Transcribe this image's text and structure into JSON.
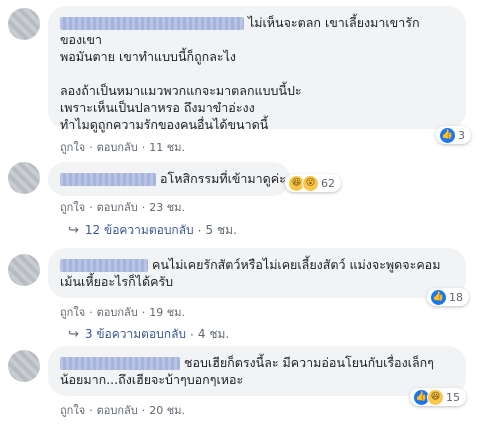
{
  "action_like": "ถูกใจ",
  "action_reply": "ตอบกลับ",
  "comments": [
    {
      "lines": [
        "ไม่เห็นจะตลก เขาเลี้ยงมาเขารัก",
        "ของเขา",
        "พอมันตาย เขาทำแบบนี้ก็ถูกละไง",
        "",
        "ลองถ้าเป็นหมาแมวพวกแกจะมาตลกแบบนี้ปะ",
        "เพราะเห็นเป็นปลาหรอ ถึงมาขำอ่ะงง",
        "ทำไมดูถูกความรักของคนอื่นได้ขนาดนี้"
      ],
      "time": "11 ชม.",
      "reaction_count": "3",
      "reactions": [
        "like"
      ]
    },
    {
      "lines": [
        "อโหสิกรรมที่เข้ามาดูค่ะ"
      ],
      "time": "23 ชม.",
      "reaction_count": "62",
      "reactions": [
        "haha",
        "wow"
      ]
    },
    {
      "lines": [
        "คนไม่เคยรักสัตว์หรือไม่เคยเลี้ยงสัตว์ แม่งจะพูดจะคอม",
        "เม้นเหี้ยอะไรก็ได้ครับ"
      ],
      "time": "19 ชม.",
      "reaction_count": "18",
      "reactions": [
        "like"
      ]
    },
    {
      "lines": [
        "ชอบเฮียก็ตรงนี้ละ มีความอ่อนโยนกับเรื่องเล็กๆ",
        "น้อยมาก...ถึงเฮียจะบ้าๆบอกๆเหอะ"
      ],
      "time": "20 ชม.",
      "reaction_count": "15",
      "reactions": [
        "like",
        "haha"
      ]
    }
  ],
  "reply_threads": [
    {
      "label": "12 ข้อความตอบกลับ",
      "time": "5 ชม."
    },
    {
      "label": "3 ข้อความตอบกลับ",
      "time": "4 ชม."
    }
  ]
}
